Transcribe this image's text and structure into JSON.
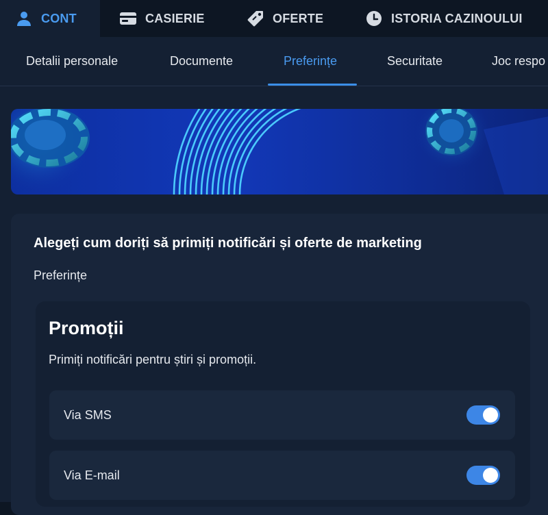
{
  "topnav": {
    "tabs": [
      {
        "label": "CONT",
        "icon": "user-icon",
        "active": true
      },
      {
        "label": "CASIERIE",
        "icon": "card-icon"
      },
      {
        "label": "OFERTE",
        "icon": "tag-icon"
      },
      {
        "label": "ISTORIA CAZINOULUI",
        "icon": "clock-icon"
      }
    ]
  },
  "subnav": {
    "items": [
      {
        "label": "Detalii personale"
      },
      {
        "label": "Documente"
      },
      {
        "label": "Preferințe",
        "active": true
      },
      {
        "label": "Securitate"
      },
      {
        "label": "Joc respo"
      }
    ]
  },
  "card": {
    "title": "Alegeți cum doriți să primiți notificări și oferte de marketing",
    "subtitle": "Preferințe"
  },
  "promo": {
    "title": "Promoții",
    "description": "Primiți notificări pentru știri și promoții.",
    "options": [
      {
        "label": "Via SMS",
        "enabled": true
      },
      {
        "label": "Via E-mail",
        "enabled": true
      }
    ]
  },
  "colors": {
    "accent": "#4a9bf0",
    "toggle_on": "#3d86e6",
    "background": "#0d1623",
    "panel": "#142033"
  }
}
